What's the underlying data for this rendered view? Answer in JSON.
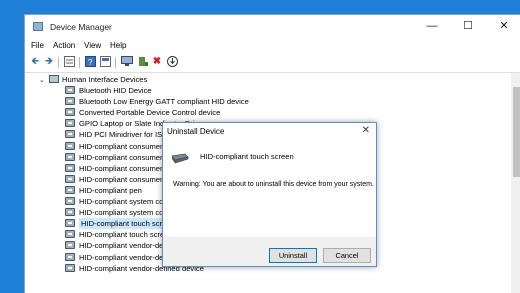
{
  "window": {
    "title": "Device Manager"
  },
  "menu": [
    "File",
    "Action",
    "View",
    "Help"
  ],
  "tree": {
    "category": "Human Interface Devices",
    "items": [
      "Bluetooth HID Device",
      "Bluetooth Low Energy GATT compliant HID device",
      "Converted Portable Device Control device",
      "GPIO Laptop or Slate Indicator Driver",
      "HID PCI Minidriver for ISS",
      "HID-compliant consumer control device",
      "HID-compliant consumer control device",
      "HID-compliant consumer control device",
      "HID-compliant consumer control device",
      "HID-compliant pen",
      "HID-compliant system controller",
      "HID-compliant system controller",
      "HID-compliant touch screen",
      "HID-compliant touch screen",
      "HID-compliant vendor-defined device",
      "HID-compliant vendor-defined device",
      "HID-compliant vendor-defined device"
    ],
    "selected_index": 12
  },
  "dialog": {
    "title": "Uninstall Device",
    "device_name": "HID-compliant touch screen",
    "warning": "Warning: You are about to uninstall this device from your system.",
    "uninstall_label": "Uninstall",
    "cancel_label": "Cancel"
  },
  "icons": {
    "toolbar": [
      "back-arrow-icon",
      "forward-arrow-icon",
      "grid-icon",
      "properties-icon",
      "help-icon",
      "panel-icon",
      "monitor-icon",
      "update-driver-icon",
      "uninstall-x-icon",
      "download-icon"
    ]
  },
  "colors": {
    "desktop": "#1e7fd8",
    "selection": "#cce8ff",
    "accent": "#0078d7"
  }
}
